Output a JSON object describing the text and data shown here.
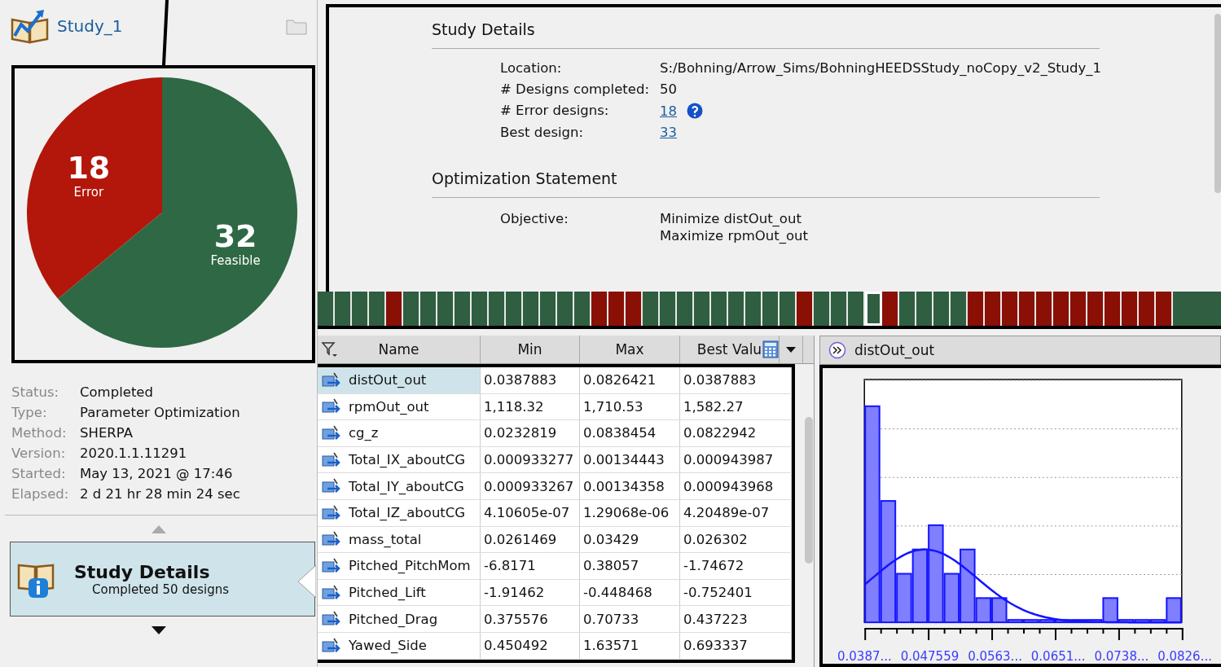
{
  "study": {
    "title": "Study_1"
  },
  "pie": {
    "segments": [
      {
        "value": "18",
        "label": "Error",
        "color": "#b3160a"
      },
      {
        "value": "32",
        "label": "Feasible",
        "color": "#2f6844"
      }
    ]
  },
  "info": [
    {
      "label": "Status:",
      "value": "Completed"
    },
    {
      "label": "Type:",
      "value": "Parameter Optimization"
    },
    {
      "label": "Method:",
      "value": "SHERPA"
    },
    {
      "label": "Version:",
      "value": "2020.1.1.11291"
    },
    {
      "label": "Started:",
      "value": "May 13, 2021 @ 17:46"
    },
    {
      "label": "Elapsed:",
      "value": "2 d 21 hr 28 min 24 sec"
    }
  ],
  "nav": {
    "title": "Study Details",
    "subtitle": "Completed 50 designs",
    "selected": true
  },
  "details": {
    "title": "Study Details",
    "rows": [
      {
        "label": "Location:",
        "value": "S:/Bohning/Arrow_Sims/BohningHEEDSStudy_noCopy_v2_Study_1",
        "kind": "text"
      },
      {
        "label": "# Designs completed:",
        "value": "50",
        "kind": "text"
      },
      {
        "label": "# Error designs:",
        "value": "18",
        "kind": "link",
        "help": true
      },
      {
        "label": "Best design:",
        "value": "33",
        "kind": "link",
        "help": false
      }
    ]
  },
  "optimization": {
    "title": "Optimization Statement",
    "label": "Objective:",
    "objectives": [
      "Minimize distOut_out",
      "Maximize rpmOut_out"
    ]
  },
  "designs": [
    {
      "color": "#2f5e40",
      "selected": false
    },
    {
      "color": "#2f5e40",
      "selected": false
    },
    {
      "color": "#2f5e40",
      "selected": false
    },
    {
      "color": "#2f5e40",
      "selected": false
    },
    {
      "color": "#8a0f04",
      "selected": false
    },
    {
      "color": "#2f5e40",
      "selected": false
    },
    {
      "color": "#2f5e40",
      "selected": false
    },
    {
      "color": "#2f5e40",
      "selected": false
    },
    {
      "color": "#2f5e40",
      "selected": false
    },
    {
      "color": "#2f5e40",
      "selected": false
    },
    {
      "color": "#2f5e40",
      "selected": false
    },
    {
      "color": "#2f5e40",
      "selected": false
    },
    {
      "color": "#2f5e40",
      "selected": false
    },
    {
      "color": "#2f5e40",
      "selected": false
    },
    {
      "color": "#2f5e40",
      "selected": false
    },
    {
      "color": "#2f5e40",
      "selected": false
    },
    {
      "color": "#8a0f04",
      "selected": false
    },
    {
      "color": "#8a0f04",
      "selected": false
    },
    {
      "color": "#8a0f04",
      "selected": false
    },
    {
      "color": "#2f5e40",
      "selected": false
    },
    {
      "color": "#2f5e40",
      "selected": false
    },
    {
      "color": "#2f5e40",
      "selected": false
    },
    {
      "color": "#2f5e40",
      "selected": false
    },
    {
      "color": "#2f5e40",
      "selected": false
    },
    {
      "color": "#2f5e40",
      "selected": false
    },
    {
      "color": "#2f5e40",
      "selected": false
    },
    {
      "color": "#2f5e40",
      "selected": false
    },
    {
      "color": "#2f5e40",
      "selected": false
    },
    {
      "color": "#8a0f04",
      "selected": false
    },
    {
      "color": "#2f5e40",
      "selected": false
    },
    {
      "color": "#2f5e40",
      "selected": false
    },
    {
      "color": "#2f5e40",
      "selected": false
    },
    {
      "color": "#2f5e40",
      "selected": true
    },
    {
      "color": "#8a0f04",
      "selected": false
    },
    {
      "color": "#2f5e40",
      "selected": false
    },
    {
      "color": "#2f5e40",
      "selected": false
    },
    {
      "color": "#2f5e40",
      "selected": false
    },
    {
      "color": "#2f5e40",
      "selected": false
    },
    {
      "color": "#8a0f04",
      "selected": false
    },
    {
      "color": "#8a0f04",
      "selected": false
    },
    {
      "color": "#8a0f04",
      "selected": false
    },
    {
      "color": "#8a0f04",
      "selected": false
    },
    {
      "color": "#8a0f04",
      "selected": false
    },
    {
      "color": "#8a0f04",
      "selected": false
    },
    {
      "color": "#8a0f04",
      "selected": false
    },
    {
      "color": "#8a0f04",
      "selected": false
    },
    {
      "color": "#8a0f04",
      "selected": false
    },
    {
      "color": "#8a0f04",
      "selected": false
    },
    {
      "color": "#8a0f04",
      "selected": false
    },
    {
      "color": "#8a0f04",
      "selected": false
    }
  ],
  "table": {
    "columns": [
      "Name",
      "Min",
      "Max",
      "Best Valu"
    ],
    "rows": [
      {
        "name": "distOut_out",
        "min": "0.0387883",
        "max": "0.0826421",
        "best": "0.0387883",
        "selected": true
      },
      {
        "name": "rpmOut_out",
        "min": "1,118.32",
        "max": "1,710.53",
        "best": "1,582.27",
        "selected": false
      },
      {
        "name": "cg_z",
        "min": "0.0232819",
        "max": "0.0838454",
        "best": "0.0822942",
        "selected": false
      },
      {
        "name": "Total_IX_aboutCG",
        "min": "0.000933277",
        "max": "0.00134443",
        "best": "0.000943987",
        "selected": false
      },
      {
        "name": "Total_IY_aboutCG",
        "min": "0.000933267",
        "max": "0.00134358",
        "best": "0.000943968",
        "selected": false
      },
      {
        "name": "Total_IZ_aboutCG",
        "min": "4.10605e-07",
        "max": "1.29068e-06",
        "best": "4.20489e-07",
        "selected": false
      },
      {
        "name": "mass_total",
        "min": "0.0261469",
        "max": "0.03429",
        "best": "0.026302",
        "selected": false
      },
      {
        "name": "Pitched_PitchMom",
        "min": "-6.8171",
        "max": "0.38057",
        "best": "-1.74672",
        "selected": false
      },
      {
        "name": "Pitched_Lift",
        "min": "-1.91462",
        "max": "-0.448468",
        "best": "-0.752401",
        "selected": false
      },
      {
        "name": "Pitched_Drag",
        "min": "0.375576",
        "max": "0.70733",
        "best": "0.437223",
        "selected": false
      },
      {
        "name": "Yawed_Side",
        "min": "0.450492",
        "max": "1.63571",
        "best": "0.693337",
        "selected": false
      }
    ]
  },
  "histogram": {
    "title": "distOut_out",
    "x_labels": [
      "0.0387...",
      "0.047559",
      "0.0563...",
      "0.0651...",
      "0.0738...",
      "0.0826..."
    ]
  }
}
